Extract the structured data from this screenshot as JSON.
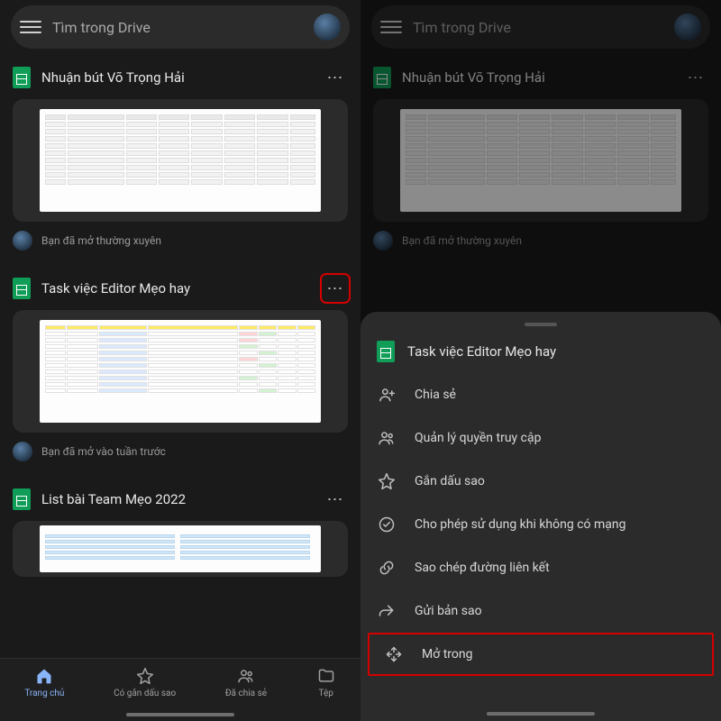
{
  "search": {
    "placeholder": "Tìm trong Drive"
  },
  "files": [
    {
      "title": "Nhuận bút Võ Trọng Hải",
      "subtitle": "Bạn đã mở thường xuyên"
    },
    {
      "title": "Task việc Editor Mẹo hay",
      "subtitle": "Bạn đã mở vào tuần trước"
    },
    {
      "title": "List bài Team Mẹo 2022",
      "subtitle": ""
    }
  ],
  "nav": {
    "home": "Trang chủ",
    "starred": "Có gắn dấu sao",
    "shared": "Đã chia sẻ",
    "files": "Tệp"
  },
  "sheet": {
    "title": "Task việc Editor Mẹo hay",
    "items": {
      "share": "Chia sẻ",
      "manage_access": "Quản lý quyền truy cập",
      "star": "Gắn dấu sao",
      "offline": "Cho phép sử dụng khi không có mạng",
      "copy_link": "Sao chép đường liên kết",
      "send_copy": "Gửi bản sao",
      "open_in": "Mở trong"
    }
  },
  "icons": {
    "more": "⋯"
  }
}
